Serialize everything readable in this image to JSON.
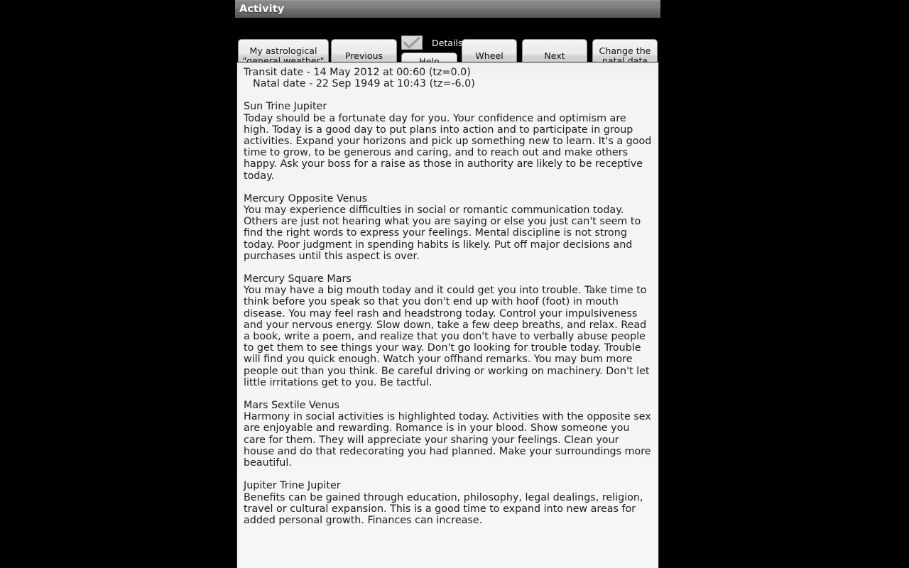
{
  "window": {
    "title": "Activity"
  },
  "toolbar": {
    "general_weather_label": "My astrological\n\"general weather\"",
    "general_weather_line1": "My astrological",
    "general_weather_line2": "\"general weather\"",
    "previous_label": "Previous",
    "help_label": "Help",
    "wheel_label": "Wheel",
    "next_label": "Next",
    "change_natal_line1": "Change the",
    "change_natal_line2": "natal data",
    "details_label": "Details",
    "details_checked": true,
    "checkmark_icon": "check-icon"
  },
  "content": {
    "transit_date_line": "Transit date - 14 May 2012 at 00:60 (tz=0.0)",
    "natal_date_line": "Natal date - 22 Sep 1949 at 10:43 (tz=-6.0)",
    "sections": [
      {
        "title": "Sun Trine Jupiter",
        "body": "Today should be a fortunate day for you. Your confidence and optimism are high. Today is a good day to put plans into action and to participate in group activities. Expand your horizons and pick up something new to learn. It's a good time to grow, to be generous and caring, and to reach out and make others happy. Ask your boss for a raise as those in authority are likely to be receptive today."
      },
      {
        "title": "Mercury Opposite Venus",
        "body": "You may experience difficulties in social or romantic communication today. Others are just not hearing what you are saying or else you just can't seem to find the right words to express your feelings. Mental discipline is not strong today. Poor judgment in spending habits is likely. Put off major decisions and purchases until this aspect is over."
      },
      {
        "title": "Mercury Square Mars",
        "body": "You may have a big mouth today and it could get you into trouble. Take time to think before you speak so that you don't end up with hoof (foot) in mouth disease. You may feel rash and headstrong today. Control your impulsiveness and your nervous energy. Slow down, take a few deep breaths, and relax. Read a book, write a poem, and realize that you don't have to verbally abuse people to get them to see things your way. Don't go looking for trouble today. Trouble will find you quick enough. Watch your offhand remarks. You may bum more people out than you think. Be careful driving or working on machinery. Don't let little irritations get to you. Be tactful."
      },
      {
        "title": "Mars Sextile Venus",
        "body": "Harmony in social activities is highlighted today. Activities with the opposite sex are enjoyable and rewarding. Romance is in your blood. Show someone you care for them. They will appreciate your sharing your feelings. Clean your house and do that redecorating you had planned. Make your surroundings more beautiful."
      },
      {
        "title": "Jupiter Trine Jupiter",
        "body": "Benefits can be gained through education, philosophy, legal dealings, religion, travel or cultural expansion. This is a good time to expand into new areas for added personal growth. Finances can increase."
      }
    ]
  },
  "colors": {
    "letterbox": "#000000",
    "title_bar": "#7e7e7e",
    "button_face": "#e6e6e6",
    "content_bg": "#f5f6f7",
    "text": "#1b1b1b"
  }
}
